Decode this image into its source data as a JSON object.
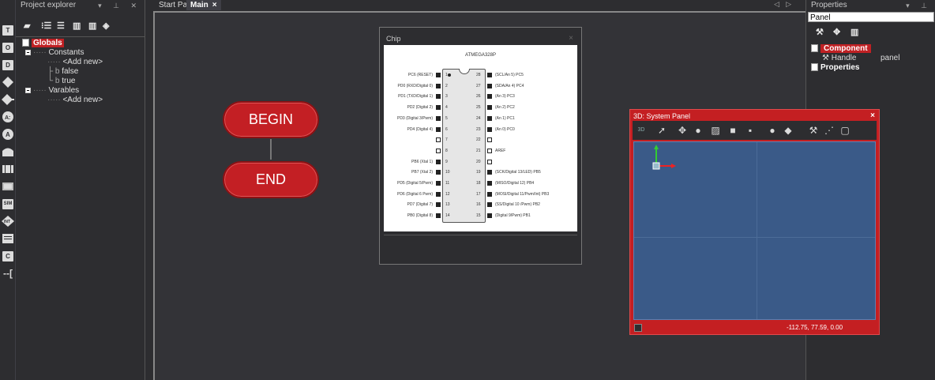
{
  "palette": {
    "items": [
      "T",
      "O",
      "D",
      "",
      "",
      "A:",
      "A",
      "",
      "",
      "",
      "SIM",
      "INT",
      "",
      "C",
      "--["
    ]
  },
  "project_explorer": {
    "title": "Project explorer",
    "tree": {
      "globals": "Globals",
      "constants": "Constants",
      "add_new_1": "<Add new>",
      "false_item": "false",
      "true_item": "true",
      "variables": "Varables",
      "add_new_2": "<Add new>"
    }
  },
  "tabs": [
    {
      "label": "Start Page",
      "active": false
    },
    {
      "label": "Main",
      "active": true,
      "close": "×"
    }
  ],
  "canvas": {
    "begin_label": "BEGIN",
    "end_label": "END"
  },
  "chip_window": {
    "title": "Chip",
    "close": "×",
    "chip_name": "ATMEGA328P",
    "left_pins": [
      {
        "num": "1",
        "label": "PC6 (RESET)",
        "filled": true
      },
      {
        "num": "2",
        "label": "PD0 (RXD/Digital 0)",
        "filled": true
      },
      {
        "num": "3",
        "label": "PD1 (TXD/Digital 1)",
        "filled": true
      },
      {
        "num": "4",
        "label": "PD2 (Digital 2)",
        "filled": true
      },
      {
        "num": "5",
        "label": "PD3 (Digital 3/Pwm)",
        "filled": true
      },
      {
        "num": "6",
        "label": "PD4 (Digital 4)",
        "filled": true
      },
      {
        "num": "7",
        "label": "",
        "filled": false
      },
      {
        "num": "8",
        "label": "",
        "filled": false
      },
      {
        "num": "9",
        "label": "PB6 (Xtal 1)",
        "filled": true
      },
      {
        "num": "10",
        "label": "PB7 (Xtal 2)",
        "filled": true
      },
      {
        "num": "11",
        "label": "PD5 (Digital 5/Pwm)",
        "filled": true
      },
      {
        "num": "12",
        "label": "PD6 (Digital 6 Pwm)",
        "filled": true
      },
      {
        "num": "13",
        "label": "PD7 (Digital 7)",
        "filled": true
      },
      {
        "num": "14",
        "label": "PB0 (Digital 8)",
        "filled": true
      }
    ],
    "right_pins": [
      {
        "num": "28",
        "label": "(SCL/An 5) PC5",
        "filled": true
      },
      {
        "num": "27",
        "label": "(SDA/An 4) PC4",
        "filled": true
      },
      {
        "num": "26",
        "label": "(An 3) PC3",
        "filled": true
      },
      {
        "num": "25",
        "label": "(An 2) PC2",
        "filled": true
      },
      {
        "num": "24",
        "label": "(An 1) PC1",
        "filled": true
      },
      {
        "num": "23",
        "label": "(An 0) PC0",
        "filled": true
      },
      {
        "num": "22",
        "label": "",
        "filled": false
      },
      {
        "num": "21",
        "label": "AREF",
        "filled": false
      },
      {
        "num": "20",
        "label": "",
        "filled": false
      },
      {
        "num": "19",
        "label": "(SCK/Digital 13/LED) PB5",
        "filled": true
      },
      {
        "num": "18",
        "label": "(MISO/Digital 12) PB4",
        "filled": true
      },
      {
        "num": "17",
        "label": "(MOSI/Digital 11/Pwm/Int) PB3",
        "filled": true
      },
      {
        "num": "16",
        "label": "(SS/Digital 10 /Pwm) PB2",
        "filled": true
      },
      {
        "num": "15",
        "label": "(Digital 9/Pwm) PB1",
        "filled": true
      }
    ]
  },
  "properties": {
    "title": "Properties",
    "search_value": "Panel",
    "component_label": "Component",
    "handle_label": "Handle",
    "handle_value": "panel",
    "properties_label": "Properties"
  },
  "system_panel": {
    "title": "3D: System Panel",
    "close": "×",
    "mode_label": "3D",
    "coords": "-112.75, 77.59, 0.00"
  },
  "colors": {
    "accent_red": "#c31f24",
    "viewport_blue": "#3a5a88",
    "dark_bg": "#2d2d30"
  }
}
